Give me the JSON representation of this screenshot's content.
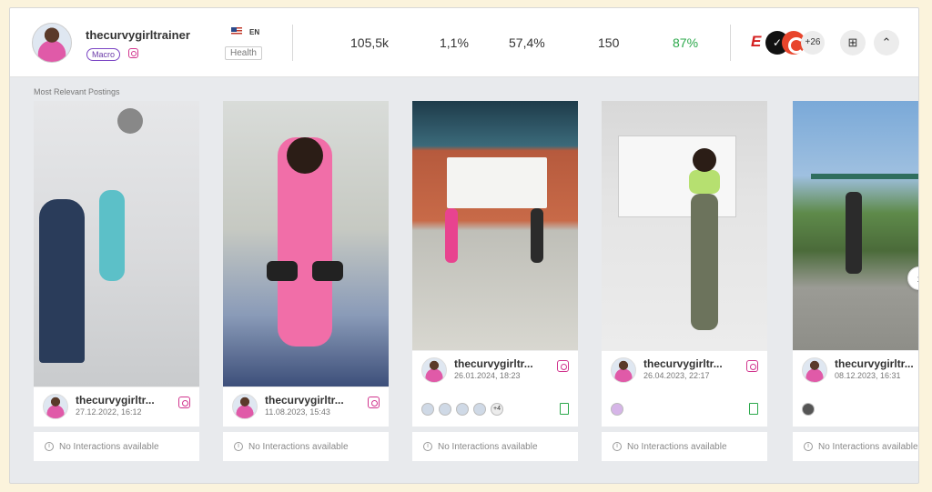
{
  "profile": {
    "username": "thecurvygirltrainer",
    "tier_badge": "Macro",
    "language": "EN",
    "category": "Health"
  },
  "stats": {
    "followers": "105,5k",
    "engagement_rate": "1,1%",
    "stat3": "57,4%",
    "stat4": "150",
    "score": "87%"
  },
  "brands": {
    "more_count": "+26"
  },
  "section_label": "Most Relevant Postings",
  "posts": [
    {
      "name": "thecurvygirltr...",
      "date": "27.12.2022, 16:12",
      "footer": "No Interactions available"
    },
    {
      "name": "thecurvygirltr...",
      "date": "11.08.2023, 15:43",
      "footer": "No Interactions available"
    },
    {
      "name": "thecurvygirltr...",
      "date": "26.01.2024, 18:23",
      "footer": "No Interactions available",
      "more_tag": "+4"
    },
    {
      "name": "thecurvygirltr...",
      "date": "26.04.2023, 22:17",
      "footer": "No Interactions available"
    },
    {
      "name": "thecurvygirltr...",
      "date": "08.12.2023, 16:31",
      "footer": "No Interactions available"
    }
  ],
  "colors": {
    "macro": "#7a44c4",
    "instagram": "#d1358e",
    "positive": "#2aa84a"
  },
  "icons": [
    "avatar",
    "instagram-icon",
    "us-flag-icon",
    "espn-logo",
    "nike-logo",
    "brand-c-logo",
    "add-to-folder-icon",
    "chevron-up-icon",
    "chevron-right-icon",
    "info-icon",
    "verified-list-icon"
  ]
}
